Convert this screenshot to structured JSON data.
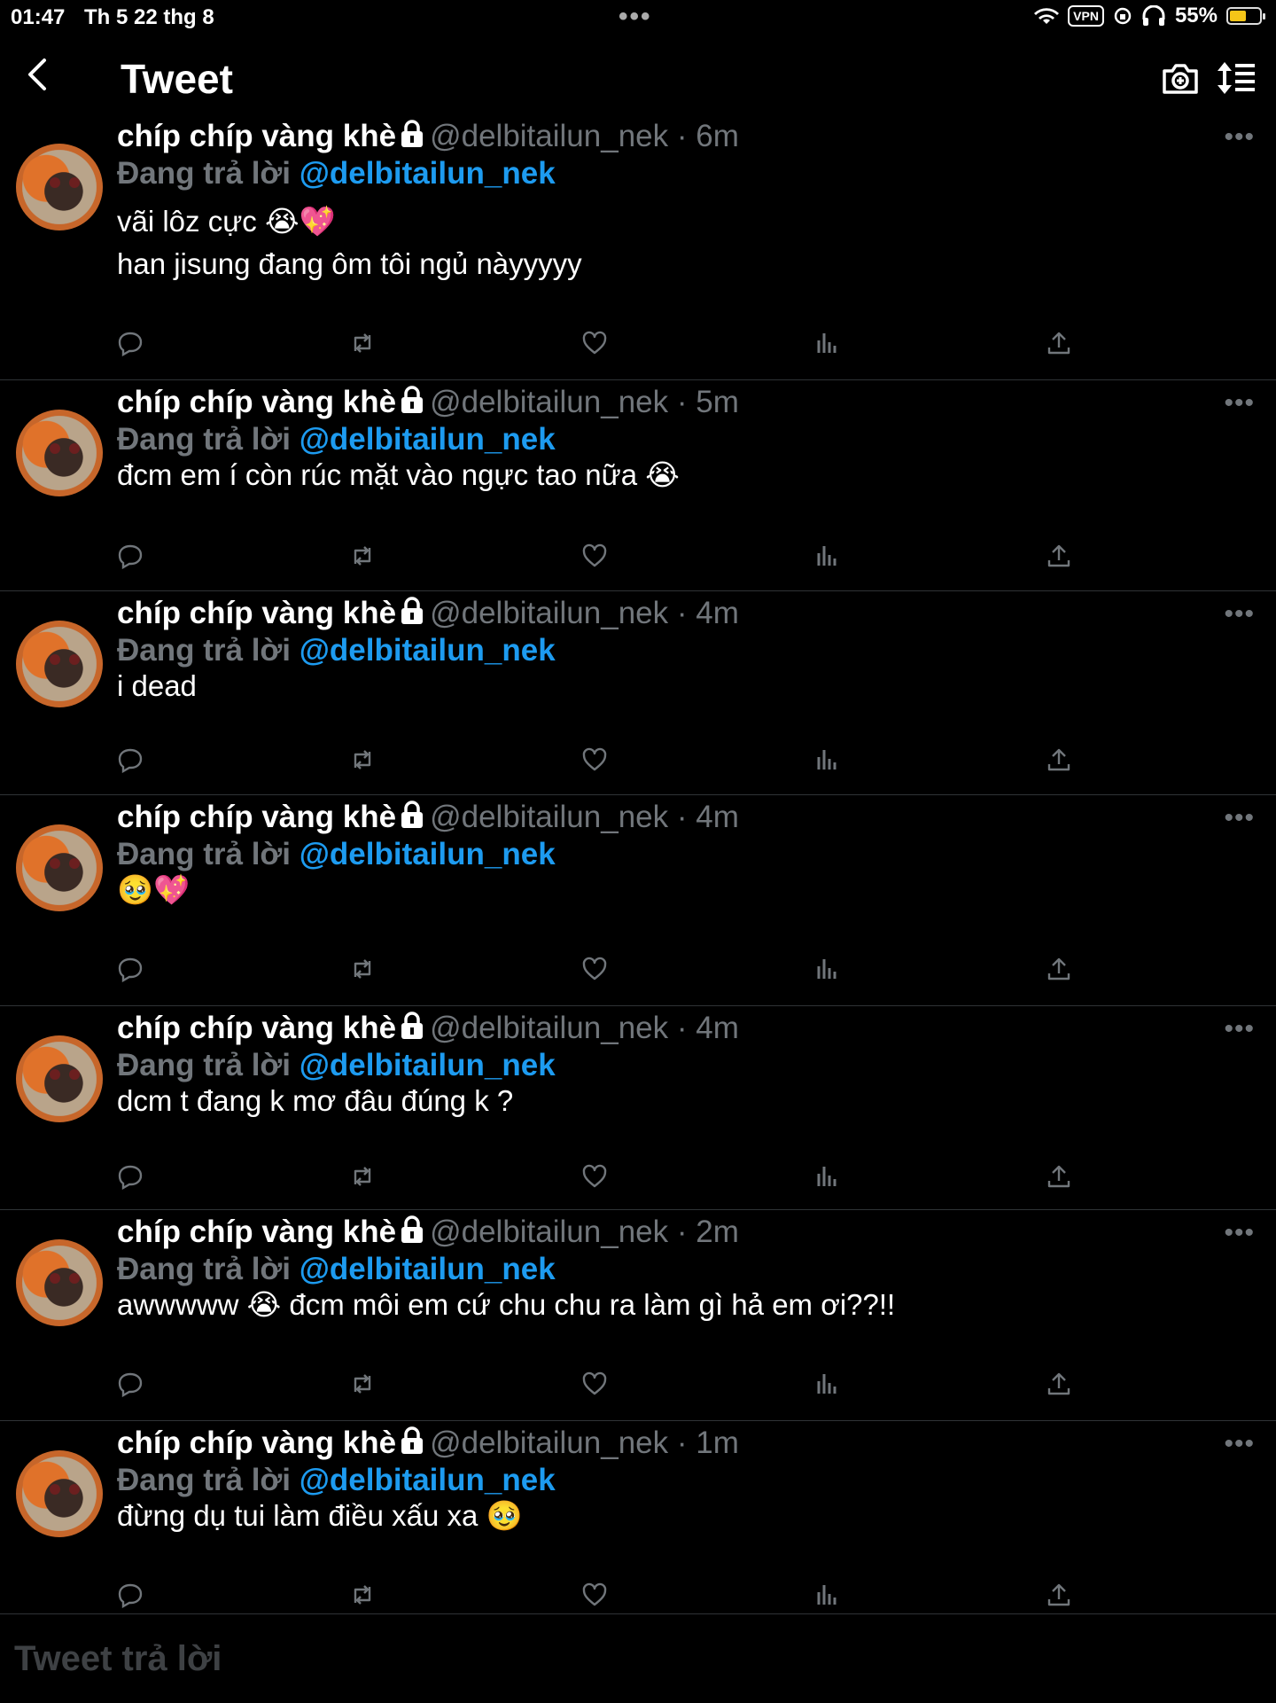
{
  "status": {
    "time": "01:47",
    "date": "Th 5 22 thg 8",
    "battery": "55%",
    "vpn": "VPN",
    "battery_level": 0.55
  },
  "header": {
    "title": "Tweet"
  },
  "author": {
    "name": "chíp chíp vàng khè",
    "handle": "@delbitailun_nek",
    "reply_prefix": "Đang trả lời",
    "reply_to": "@delbitailun_nek"
  },
  "tweets": [
    {
      "time": "· 6m",
      "text": "vãi lôz cực 😭💖\nhan jisung đang ôm tôi ngủ nàyyyyy"
    },
    {
      "time": "· 5m",
      "text": "đcm em í còn rúc mặt vào ngực tao nữa 😭"
    },
    {
      "time": "· 4m",
      "text": "i dead"
    },
    {
      "time": "· 4m",
      "text": "🥹💖"
    },
    {
      "time": "· 4m",
      "text": "dcm t đang k mơ đâu đúng k ?"
    },
    {
      "time": "· 2m",
      "text": "awwwww 😭 đcm môi em cứ chu chu ra làm gì hả em ơi??!!"
    },
    {
      "time": "· 1m",
      "text": "đừng dụ tui làm điều xấu xa 🥹"
    }
  ],
  "reply_bar": {
    "placeholder": "Tweet trả lời"
  },
  "colors": {
    "accent": "#1d9bf0",
    "muted": "#71767b",
    "background": "#000000"
  }
}
